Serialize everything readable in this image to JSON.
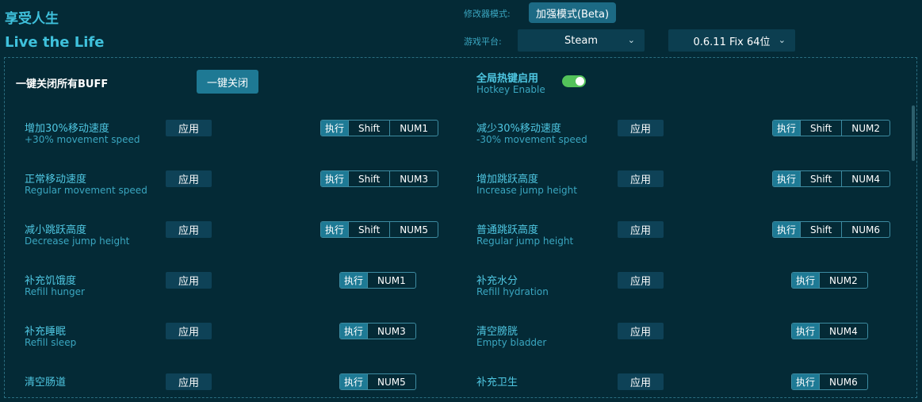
{
  "app": {
    "title_cn": "享受人生",
    "title_en": "Live the Life"
  },
  "header": {
    "mode_label": "修改器模式:",
    "mode_value": "加强模式(Beta)",
    "platform_label": "游戏平台:",
    "platform_value": "Steam",
    "version_value": "0.6.11 Fix 64位"
  },
  "panel": {
    "all_buff_label": "一键关闭所有BUFF",
    "close_all_button": "一键关闭",
    "hotkey_cn": "全局热键启用",
    "hotkey_en": "Hotkey Enable",
    "hotkey_enabled": true,
    "apply_label": "应用",
    "exec_label": "执行"
  },
  "cheats": [
    {
      "cn": "增加30%移动速度",
      "en": "+30% movement speed",
      "keys": [
        "Shift",
        "NUM1"
      ]
    },
    {
      "cn": "减少30%移动速度",
      "en": "-30% movement speed",
      "keys": [
        "Shift",
        "NUM2"
      ]
    },
    {
      "cn": "正常移动速度",
      "en": "Regular movement speed",
      "keys": [
        "Shift",
        "NUM3"
      ]
    },
    {
      "cn": "增加跳跃高度",
      "en": "Increase jump height",
      "keys": [
        "Shift",
        "NUM4"
      ]
    },
    {
      "cn": "减小跳跃高度",
      "en": "Decrease jump height",
      "keys": [
        "Shift",
        "NUM5"
      ]
    },
    {
      "cn": "普通跳跃高度",
      "en": "Regular jump height",
      "keys": [
        "Shift",
        "NUM6"
      ]
    },
    {
      "cn": "补充饥饿度",
      "en": "Refill hunger",
      "keys": [
        "NUM1"
      ]
    },
    {
      "cn": "补充水分",
      "en": "Refill hydration",
      "keys": [
        "NUM2"
      ]
    },
    {
      "cn": "补充睡眠",
      "en": "Refill sleep",
      "keys": [
        "NUM3"
      ]
    },
    {
      "cn": "清空膀胱",
      "en": "Empty bladder",
      "keys": [
        "NUM4"
      ]
    },
    {
      "cn": "清空肠道",
      "en": "",
      "keys": [
        "NUM5"
      ]
    },
    {
      "cn": "补充卫生",
      "en": "",
      "keys": [
        "NUM6"
      ]
    }
  ]
}
